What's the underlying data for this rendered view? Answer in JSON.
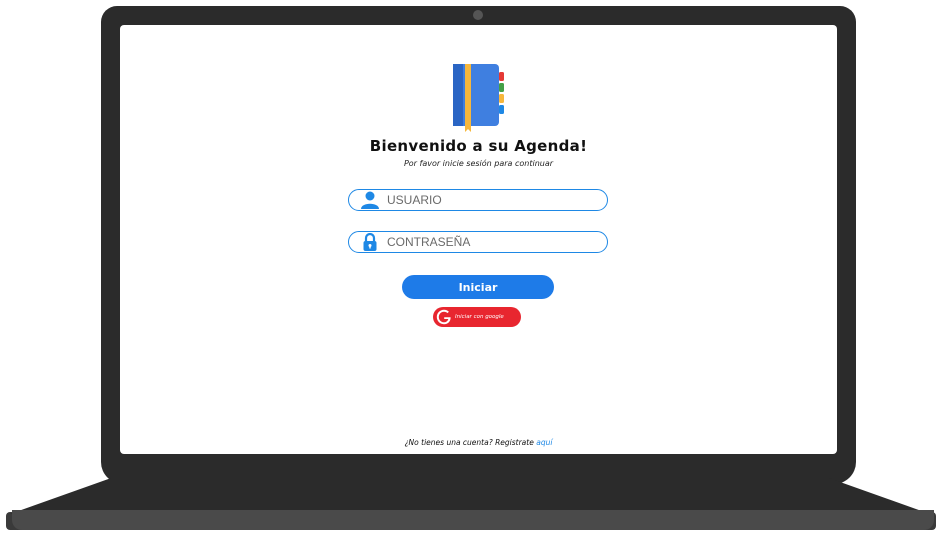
{
  "logo": {
    "icon": "notebook-icon"
  },
  "title": "Bienvenido a su Agenda!",
  "subtitle": "Por favor inicie sesión para continuar",
  "form": {
    "username": {
      "placeholder": "USUARIO",
      "value": "",
      "icon": "user-icon"
    },
    "password": {
      "placeholder": "CONTRASEÑA",
      "value": "",
      "icon": "lock-icon"
    },
    "login_label": "Iniciar",
    "google_label": "Iniciar con google"
  },
  "footer": {
    "text": "¿No tienes una cuenta? Registrate ",
    "link": "aquí"
  },
  "colors": {
    "accent": "#1e88e5",
    "button": "#1e7be8",
    "google": "#e8262f",
    "bezel": "#2b2b2b"
  }
}
